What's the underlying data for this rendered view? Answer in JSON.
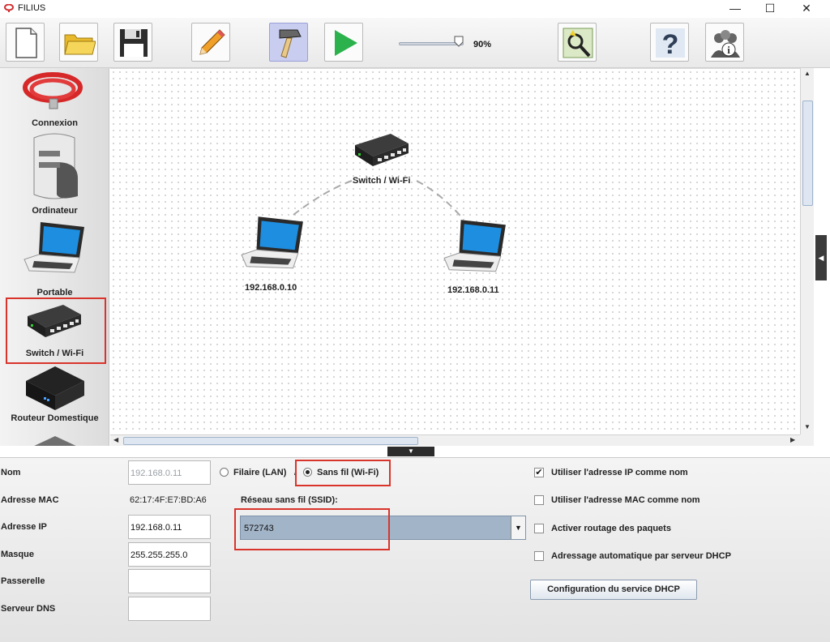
{
  "window": {
    "title": "FILIUS",
    "minimize_icon": "—",
    "maximize_icon": "☐",
    "close_icon": "✕"
  },
  "toolbar": {
    "buttons": [
      "new-file-icon",
      "open-folder-icon",
      "save-floppy-icon",
      "edit-pencil-icon",
      "design-hammer-icon",
      "run-play-icon",
      "software-wizard-icon",
      "help-icon",
      "about-team-icon"
    ],
    "zoom_level": "90%"
  },
  "palette": {
    "items": [
      {
        "label": "Connexion",
        "icon": "cable-icon"
      },
      {
        "label": "Ordinateur",
        "icon": "computer-tower-icon"
      },
      {
        "label": "Portable",
        "icon": "laptop-icon"
      },
      {
        "label": "Switch / Wi-Fi",
        "icon": "switch-icon",
        "highlighted": true
      },
      {
        "label": "Routeur Domestique",
        "icon": "home-router-icon"
      }
    ]
  },
  "canvas": {
    "nodes": [
      {
        "label": "Switch / Wi-Fi",
        "type": "switch-icon"
      },
      {
        "label": "192.168.0.10",
        "type": "laptop-icon"
      },
      {
        "label": "192.168.0.11",
        "type": "laptop-icon"
      }
    ]
  },
  "properties": {
    "fields": {
      "name_label": "Nom",
      "name_value": "192.168.0.11",
      "mac_label": "Adresse MAC",
      "mac_value": "62:17:4F:E7:BD:A6",
      "ip_label": "Adresse IP",
      "ip_value": "192.168.0.11",
      "mask_label": "Masque",
      "mask_value": "255.255.255.0",
      "gateway_label": "Passerelle",
      "gateway_value": "",
      "dns_label": "Serveur DNS",
      "dns_value": ""
    },
    "connection": {
      "wired_label": "Filaire (LAN)",
      "wired_selected": false,
      "wireless_label": "Sans fil (Wi-Fi)",
      "wireless_selected": true,
      "separator": "/"
    },
    "ssid": {
      "label": "Réseau sans fil (SSID):",
      "value": "572743"
    },
    "options": [
      {
        "label": "Utiliser l'adresse IP comme nom",
        "checked": true
      },
      {
        "label": "Utiliser l'adresse MAC comme nom",
        "checked": false
      },
      {
        "label": "Activer routage des paquets",
        "checked": false
      },
      {
        "label": "Adressage automatique par serveur DHCP",
        "checked": false
      }
    ],
    "dhcp_button": "Configuration du service DHCP"
  },
  "colors": {
    "highlight": "#d9342b",
    "ssid_bg": "#a2b4c8",
    "active_tool": "#c9cdf0"
  }
}
